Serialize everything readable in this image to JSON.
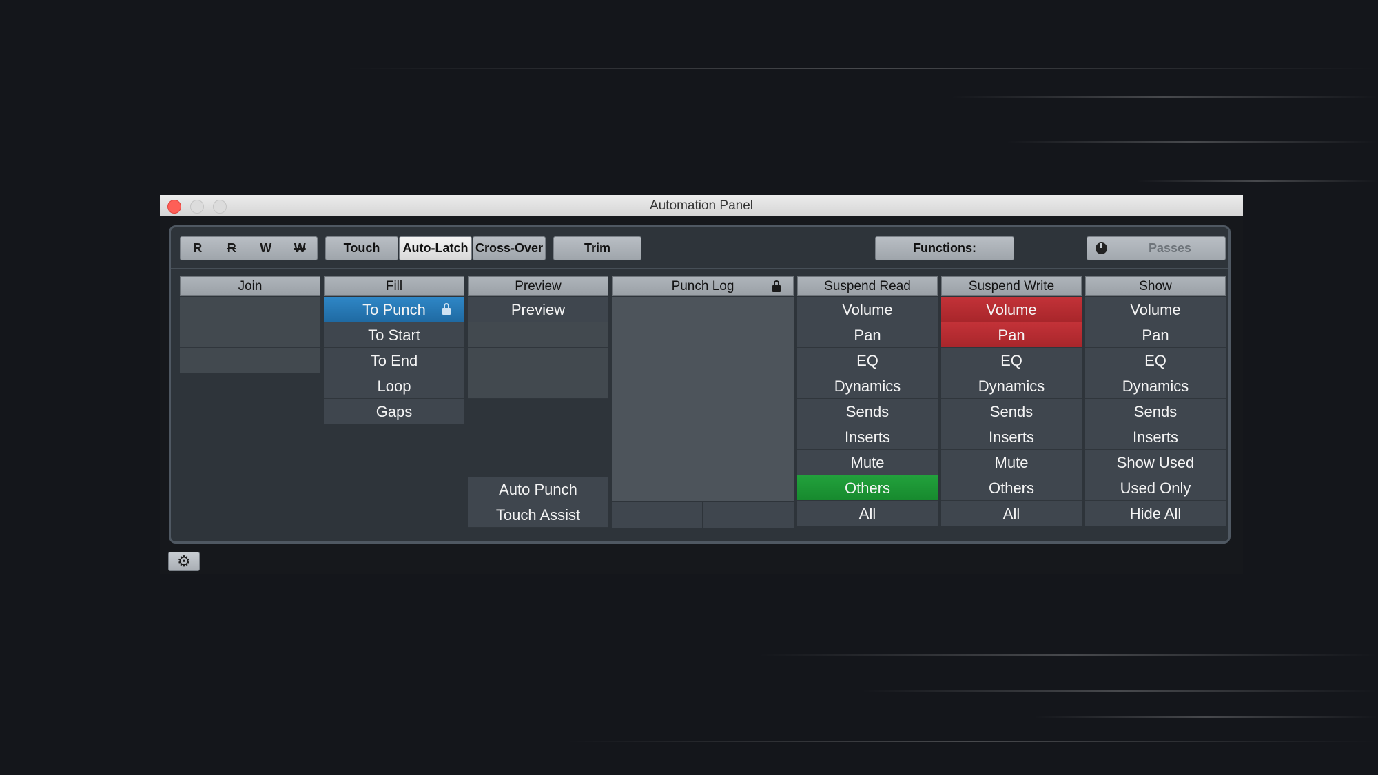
{
  "window": {
    "title": "Automation Panel"
  },
  "toolbar": {
    "rw_buttons": [
      "R",
      "R",
      "W",
      "W"
    ],
    "modes": [
      "Touch",
      "Auto-Latch",
      "Cross-Over"
    ],
    "active_mode": "Auto-Latch",
    "trim_label": "Trim",
    "functions_label": "Functions:",
    "passes_label": "Passes"
  },
  "columns": {
    "join": {
      "header": "Join"
    },
    "fill": {
      "header": "Fill",
      "items": [
        "To Punch",
        "To Start",
        "To End",
        "Loop",
        "Gaps"
      ],
      "selected": "To Punch"
    },
    "preview": {
      "header": "Preview",
      "items": [
        "Preview"
      ],
      "bottom_items": [
        "Auto Punch",
        "Touch Assist"
      ]
    },
    "punch_log": {
      "header": "Punch Log"
    },
    "suspend_read": {
      "header": "Suspend Read",
      "items": [
        "Volume",
        "Pan",
        "EQ",
        "Dynamics",
        "Sends",
        "Inserts",
        "Mute",
        "Others",
        "All"
      ],
      "active": [
        "Others"
      ]
    },
    "suspend_write": {
      "header": "Suspend Write",
      "items": [
        "Volume",
        "Pan",
        "EQ",
        "Dynamics",
        "Sends",
        "Inserts",
        "Mute",
        "Others",
        "All"
      ],
      "active": [
        "Volume",
        "Pan"
      ]
    },
    "show": {
      "header": "Show",
      "items": [
        "Volume",
        "Pan",
        "EQ",
        "Dynamics",
        "Sends",
        "Inserts",
        "Show Used",
        "Used Only",
        "Hide All"
      ]
    }
  },
  "colors": {
    "selected_blue": "#2f87c7",
    "suspend_write_red": "#c33238",
    "suspend_read_green": "#22a13c"
  },
  "icons": {
    "lock": "lock-icon",
    "settings": "gear-icon",
    "passes": "passes-knob-icon"
  }
}
